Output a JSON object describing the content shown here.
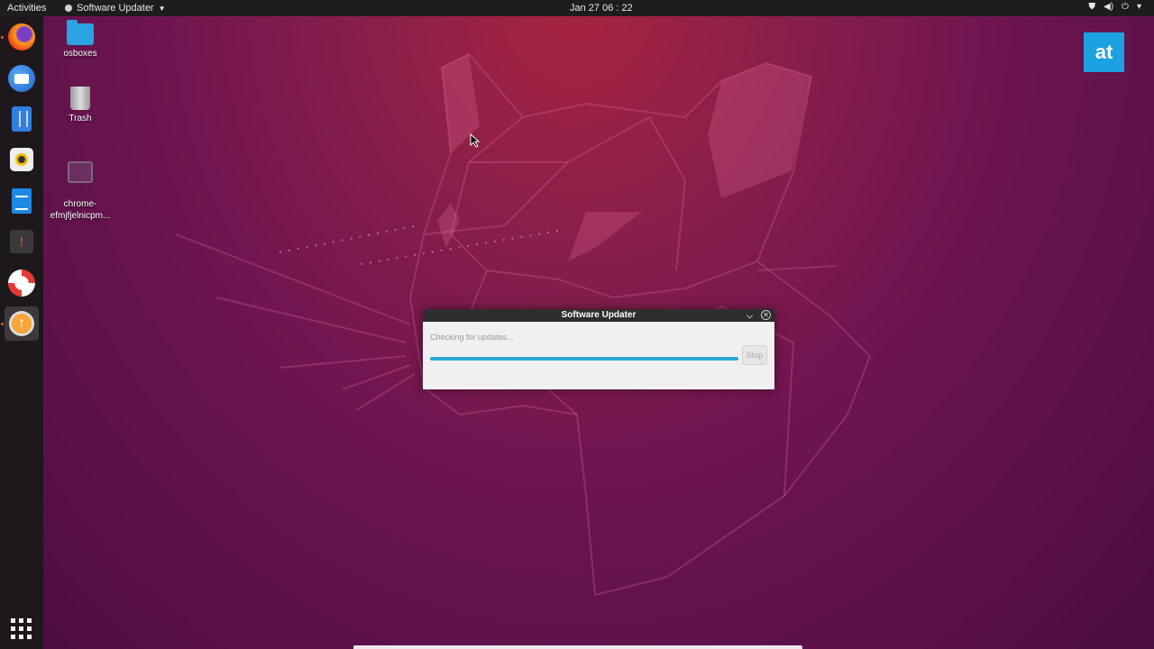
{
  "topbar": {
    "activities": "Activities",
    "app_menu": "Software Updater",
    "clock": "Jan 27  06 : 22"
  },
  "dock": {
    "items": [
      {
        "name": "Firefox",
        "icon": "firefox-icon"
      },
      {
        "name": "Thunderbird",
        "icon": "thunderbird-icon"
      },
      {
        "name": "Files",
        "icon": "files-icon"
      },
      {
        "name": "Rhythmbox",
        "icon": "rhythmbox-icon"
      },
      {
        "name": "LibreOffice Writer",
        "icon": "writer-icon"
      },
      {
        "name": "Ubuntu Software",
        "icon": "software-icon"
      },
      {
        "name": "Help",
        "icon": "help-icon"
      },
      {
        "name": "Software Updater",
        "icon": "updater-icon"
      }
    ]
  },
  "desktop": {
    "icons": [
      {
        "label": "osboxes",
        "icon": "home-folder-icon"
      },
      {
        "label": "Trash",
        "icon": "trash-icon"
      },
      {
        "label": "chrome-\nefmjfjelnicpm...",
        "icon": "chrome-app-icon"
      }
    ]
  },
  "badge": {
    "text": "at"
  },
  "dialog": {
    "title": "Software Updater",
    "status": "Checking for updates...",
    "progress": 1.0,
    "stop_label": "Stop"
  },
  "colors": {
    "accent": "#e95420",
    "progress": "#2aa7d6",
    "badge": "#1aa3e0"
  }
}
